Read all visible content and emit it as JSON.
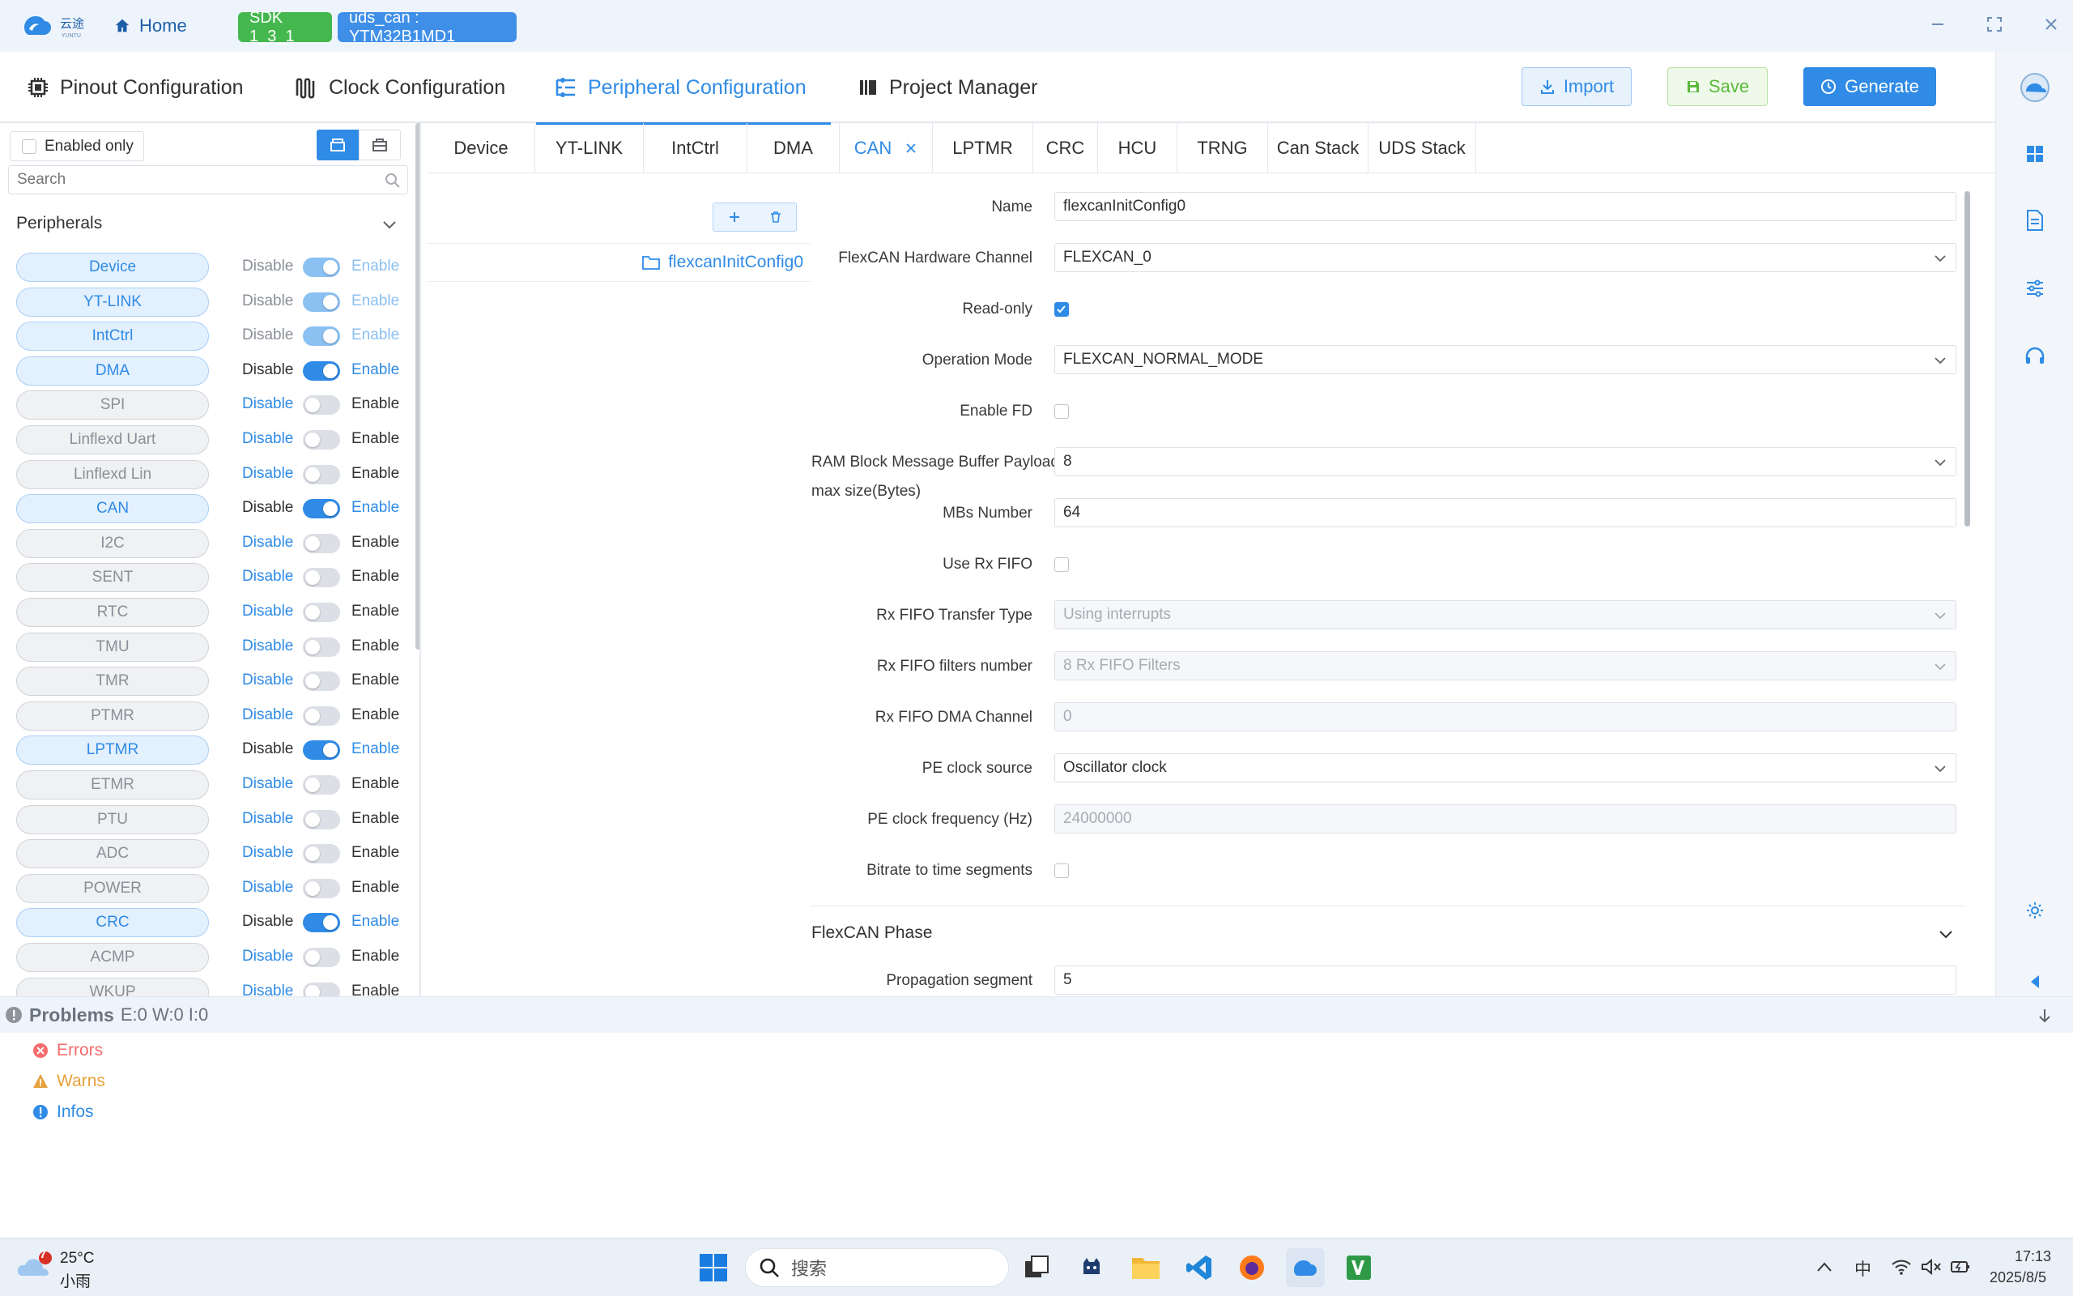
{
  "titlebar": {
    "logo_text": "云途",
    "logo_subtext": "YUNTU",
    "home_label": "Home",
    "sdk_badge": "SDK 1_3_1",
    "project_badge": "uds_can : YTM32B1MD1"
  },
  "topnav": {
    "tabs": [
      {
        "label": "Pinout Configuration",
        "icon": "chip-icon",
        "active": false
      },
      {
        "label": "Clock Configuration",
        "icon": "clock-wave-icon",
        "active": false
      },
      {
        "label": "Peripheral Configuration",
        "icon": "peripheral-icon",
        "active": true
      },
      {
        "label": "Project Manager",
        "icon": "project-icon",
        "active": false
      }
    ],
    "import_label": "Import",
    "save_label": "Save",
    "generate_label": "Generate"
  },
  "left": {
    "enabled_only_label": "Enabled only",
    "search_placeholder": "Search",
    "peripherals_title": "Peripherals",
    "disable_label": "Disable",
    "enable_label": "Enable",
    "items": [
      {
        "name": "Device",
        "enabled": true,
        "locked": true
      },
      {
        "name": "YT-LINK",
        "enabled": true,
        "locked": true
      },
      {
        "name": "IntCtrl",
        "enabled": true,
        "locked": true
      },
      {
        "name": "DMA",
        "enabled": true,
        "locked": false
      },
      {
        "name": "SPI",
        "enabled": false,
        "locked": false
      },
      {
        "name": "Linflexd Uart",
        "enabled": false,
        "locked": false
      },
      {
        "name": "Linflexd Lin",
        "enabled": false,
        "locked": false
      },
      {
        "name": "CAN",
        "enabled": true,
        "locked": false
      },
      {
        "name": "I2C",
        "enabled": false,
        "locked": false
      },
      {
        "name": "SENT",
        "enabled": false,
        "locked": false
      },
      {
        "name": "RTC",
        "enabled": false,
        "locked": false
      },
      {
        "name": "TMU",
        "enabled": false,
        "locked": false
      },
      {
        "name": "TMR",
        "enabled": false,
        "locked": false
      },
      {
        "name": "PTMR",
        "enabled": false,
        "locked": false
      },
      {
        "name": "LPTMR",
        "enabled": true,
        "locked": false
      },
      {
        "name": "ETMR",
        "enabled": false,
        "locked": false
      },
      {
        "name": "PTU",
        "enabled": false,
        "locked": false
      },
      {
        "name": "ADC",
        "enabled": false,
        "locked": false
      },
      {
        "name": "POWER",
        "enabled": false,
        "locked": false
      },
      {
        "name": "CRC",
        "enabled": true,
        "locked": false
      },
      {
        "name": "ACMP",
        "enabled": false,
        "locked": false
      },
      {
        "name": "WKUP",
        "enabled": false,
        "locked": false
      }
    ]
  },
  "subtabs": [
    "Device",
    "YT-LINK",
    "IntCtrl",
    "DMA",
    "CAN",
    "LPTMR",
    "CRC",
    "HCU",
    "TRNG",
    "Can Stack",
    "UDS Stack"
  ],
  "active_subtab": "CAN",
  "instance": {
    "name": "flexcanInitConfig0"
  },
  "form": {
    "name_label": "Name",
    "name_value": "flexcanInitConfig0",
    "channel_label": "FlexCAN Hardware Channel",
    "channel_value": "FLEXCAN_0",
    "readonly_label": "Read-only",
    "opmode_label": "Operation Mode",
    "opmode_value": "FLEXCAN_NORMAL_MODE",
    "fd_label": "Enable FD",
    "ram_label_1": "RAM Block Message Buffer Payload",
    "ram_label_2": "max size(Bytes)",
    "ram_value": "8",
    "mbs_label": "MBs Number",
    "mbs_value": "64",
    "rxfifo_label": "Use Rx FIFO",
    "rxfifo_type_label": "Rx FIFO Transfer Type",
    "rxfifo_type_value": "Using interrupts",
    "rxfifo_filters_label": "Rx FIFO filters number",
    "rxfifo_filters_value": "8 Rx FIFO Filters",
    "rxfifo_dma_label": "Rx FIFO DMA Channel",
    "rxfifo_dma_value": "0",
    "pe_source_label": "PE clock source",
    "pe_source_value": "Oscillator clock",
    "pe_freq_label": "PE clock frequency (Hz)",
    "pe_freq_value": "24000000",
    "bitrate_label": "Bitrate to time segments",
    "phase_title": "FlexCAN Phase",
    "prop_label": "Propagation segment",
    "prop_value": "5"
  },
  "problems": {
    "title": "Problems",
    "counts": "E:0 W:0 I:0",
    "errors": "Errors",
    "warns": "Warns",
    "infos": "Infos"
  },
  "taskbar": {
    "weather_temp": "25°C",
    "weather_desc": "小雨",
    "weather_badge": "7",
    "search_placeholder": "搜索",
    "ime": "中",
    "time": "17:13",
    "date": "2025/8/5"
  },
  "colors": {
    "accent": "#2f8be6",
    "success": "#44b84e",
    "error": "#f56c6c",
    "warning": "#e6a23c"
  }
}
